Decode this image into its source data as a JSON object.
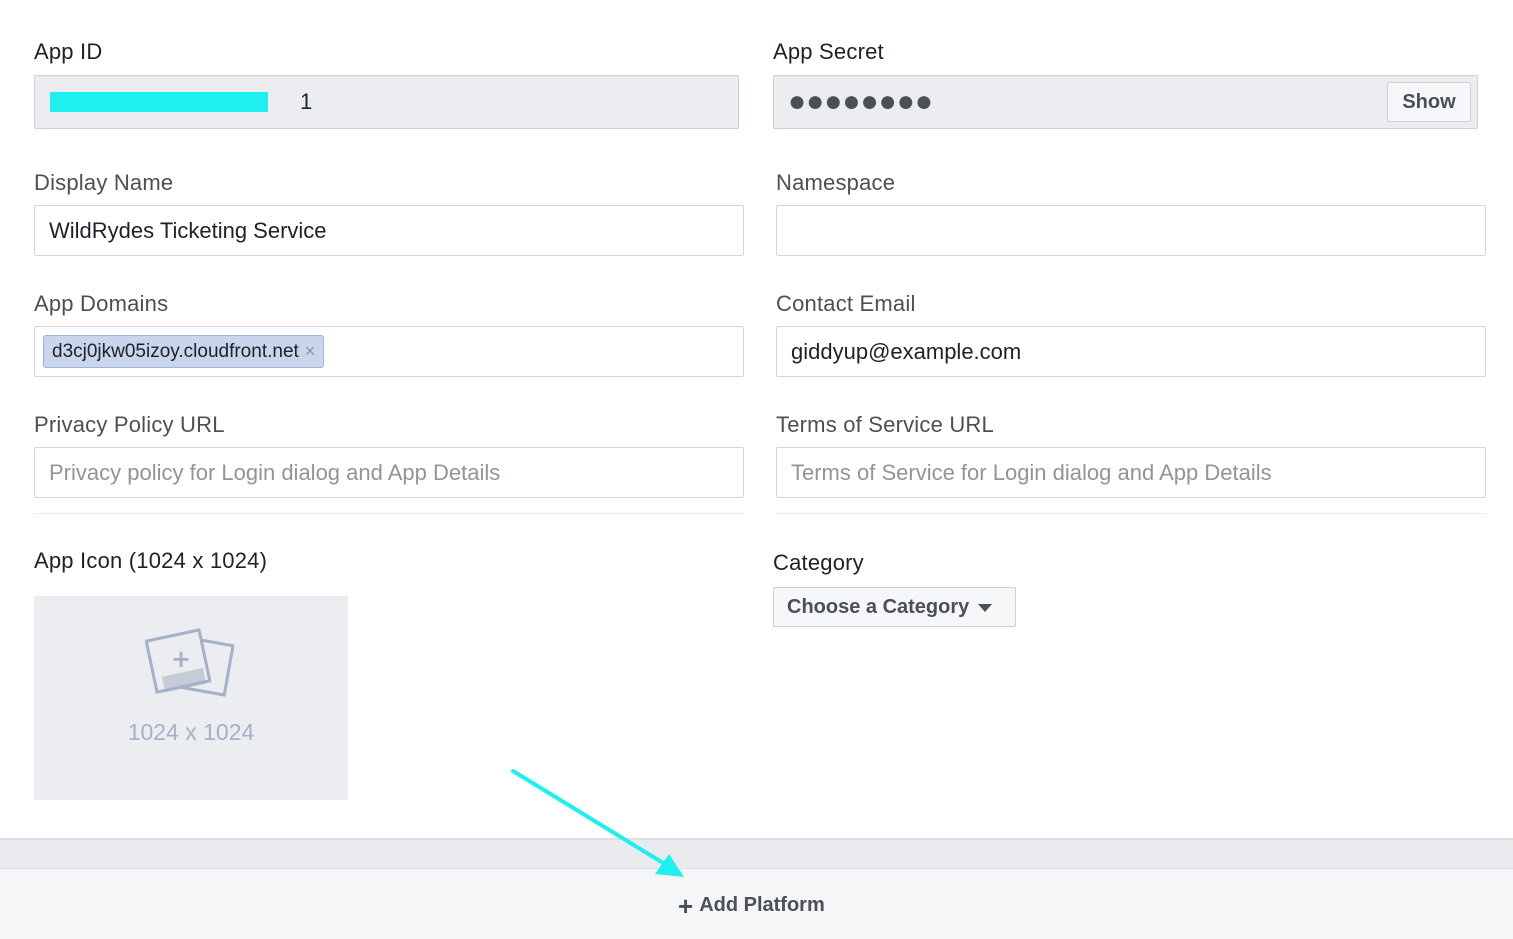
{
  "app_id": {
    "label": "App ID",
    "visible_tail": "1"
  },
  "app_secret": {
    "label": "App Secret",
    "masked_value": "●●●●●●●●",
    "show_button": "Show"
  },
  "display_name": {
    "label": "Display Name",
    "value": "WildRydes Ticketing Service"
  },
  "namespace": {
    "label": "Namespace",
    "value": ""
  },
  "app_domains": {
    "label": "App Domains",
    "tags": [
      {
        "text": "d3cj0jkw05izoy.cloudfront.net",
        "remove": "×"
      }
    ]
  },
  "contact_email": {
    "label": "Contact Email",
    "value": "giddyup@example.com"
  },
  "privacy_policy": {
    "label": "Privacy Policy URL",
    "placeholder": "Privacy policy for Login dialog and App Details"
  },
  "terms_of_service": {
    "label": "Terms of Service URL",
    "placeholder": "Terms of Service for Login dialog and App Details"
  },
  "app_icon": {
    "label": "App Icon (1024 x 1024)",
    "dimensions": "1024 x 1024",
    "icon": "add-image-icon"
  },
  "category": {
    "label": "Category",
    "button": "Choose a Category",
    "icon": "caret-down-icon"
  },
  "footer": {
    "add_platform": "Add Platform",
    "plus": "+"
  },
  "colors": {
    "annotation_arrow": "#1ef0f0",
    "masking_bar": "#1ef0f0"
  }
}
